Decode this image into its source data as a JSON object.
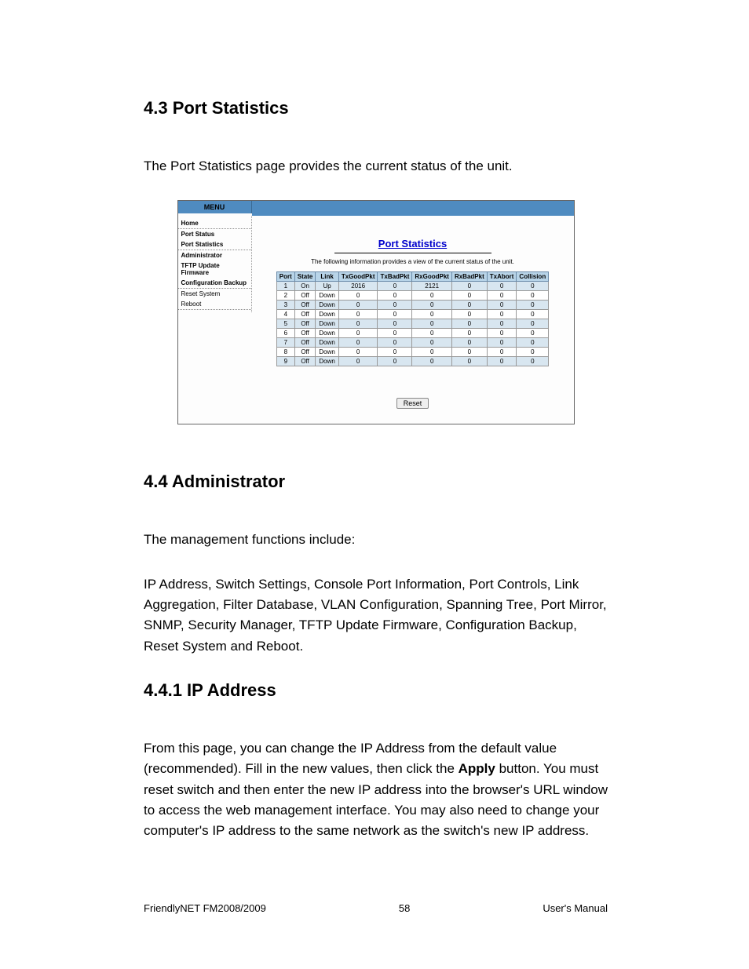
{
  "headings": {
    "h43": "4.3 Port Statistics",
    "h44": "4.4 Administrator",
    "h441": "4.4.1 IP Address"
  },
  "paragraphs": {
    "p43": "The Port Statistics page provides the current status of the unit.",
    "p44a": "The management functions include:",
    "p44b": "IP Address, Switch Settings, Console Port Information, Port Controls, Link Aggregation, Filter Database, VLAN Configuration, Spanning Tree, Port Mirror, SNMP, Security Manager, TFTP Update Firmware, Configuration Backup, Reset System and Reboot.",
    "p441a": "From this page, you can change the IP Address from the default value (recommended). Fill in the new values, then click the ",
    "p441a_bold": "Apply",
    "p441a_end": " button. You must reset switch and then enter the new IP address into the browser's URL window to access the web management interface. You may also need to change your computer's IP address to the same network as the switch's new IP address."
  },
  "screenshot": {
    "menu_header": "MENU",
    "menu_items": [
      {
        "label": "Home",
        "bold": true,
        "border": true
      },
      {
        "label": "Port Status",
        "bold": true,
        "border": false
      },
      {
        "label": "Port Statistics",
        "bold": true,
        "border": true
      },
      {
        "label": "Administrator",
        "bold": true,
        "border": false
      },
      {
        "label": "TFTP Update Firmware",
        "bold": true,
        "border": false
      },
      {
        "label": "Configuration Backup",
        "bold": true,
        "border": true
      },
      {
        "label": "Reset System",
        "bold": false,
        "border": false
      },
      {
        "label": "Reboot",
        "bold": false,
        "border": true
      }
    ],
    "title": "Port Statistics",
    "subtitle": "The following information provides a view of the current status of the unit.",
    "headers": [
      "Port",
      "State",
      "Link",
      "TxGoodPkt",
      "TxBadPkt",
      "RxGoodPkt",
      "RxBadPkt",
      "TxAbort",
      "Collision"
    ],
    "rows": [
      [
        "1",
        "On",
        "Up",
        "2016",
        "0",
        "2121",
        "0",
        "0",
        "0"
      ],
      [
        "2",
        "Off",
        "Down",
        "0",
        "0",
        "0",
        "0",
        "0",
        "0"
      ],
      [
        "3",
        "Off",
        "Down",
        "0",
        "0",
        "0",
        "0",
        "0",
        "0"
      ],
      [
        "4",
        "Off",
        "Down",
        "0",
        "0",
        "0",
        "0",
        "0",
        "0"
      ],
      [
        "5",
        "Off",
        "Down",
        "0",
        "0",
        "0",
        "0",
        "0",
        "0"
      ],
      [
        "6",
        "Off",
        "Down",
        "0",
        "0",
        "0",
        "0",
        "0",
        "0"
      ],
      [
        "7",
        "Off",
        "Down",
        "0",
        "0",
        "0",
        "0",
        "0",
        "0"
      ],
      [
        "8",
        "Off",
        "Down",
        "0",
        "0",
        "0",
        "0",
        "0",
        "0"
      ],
      [
        "9",
        "Off",
        "Down",
        "0",
        "0",
        "0",
        "0",
        "0",
        "0"
      ]
    ],
    "reset_label": "Reset"
  },
  "footer": {
    "left": "FriendlyNET FM2008/2009",
    "center": "58",
    "right": "User's Manual"
  }
}
